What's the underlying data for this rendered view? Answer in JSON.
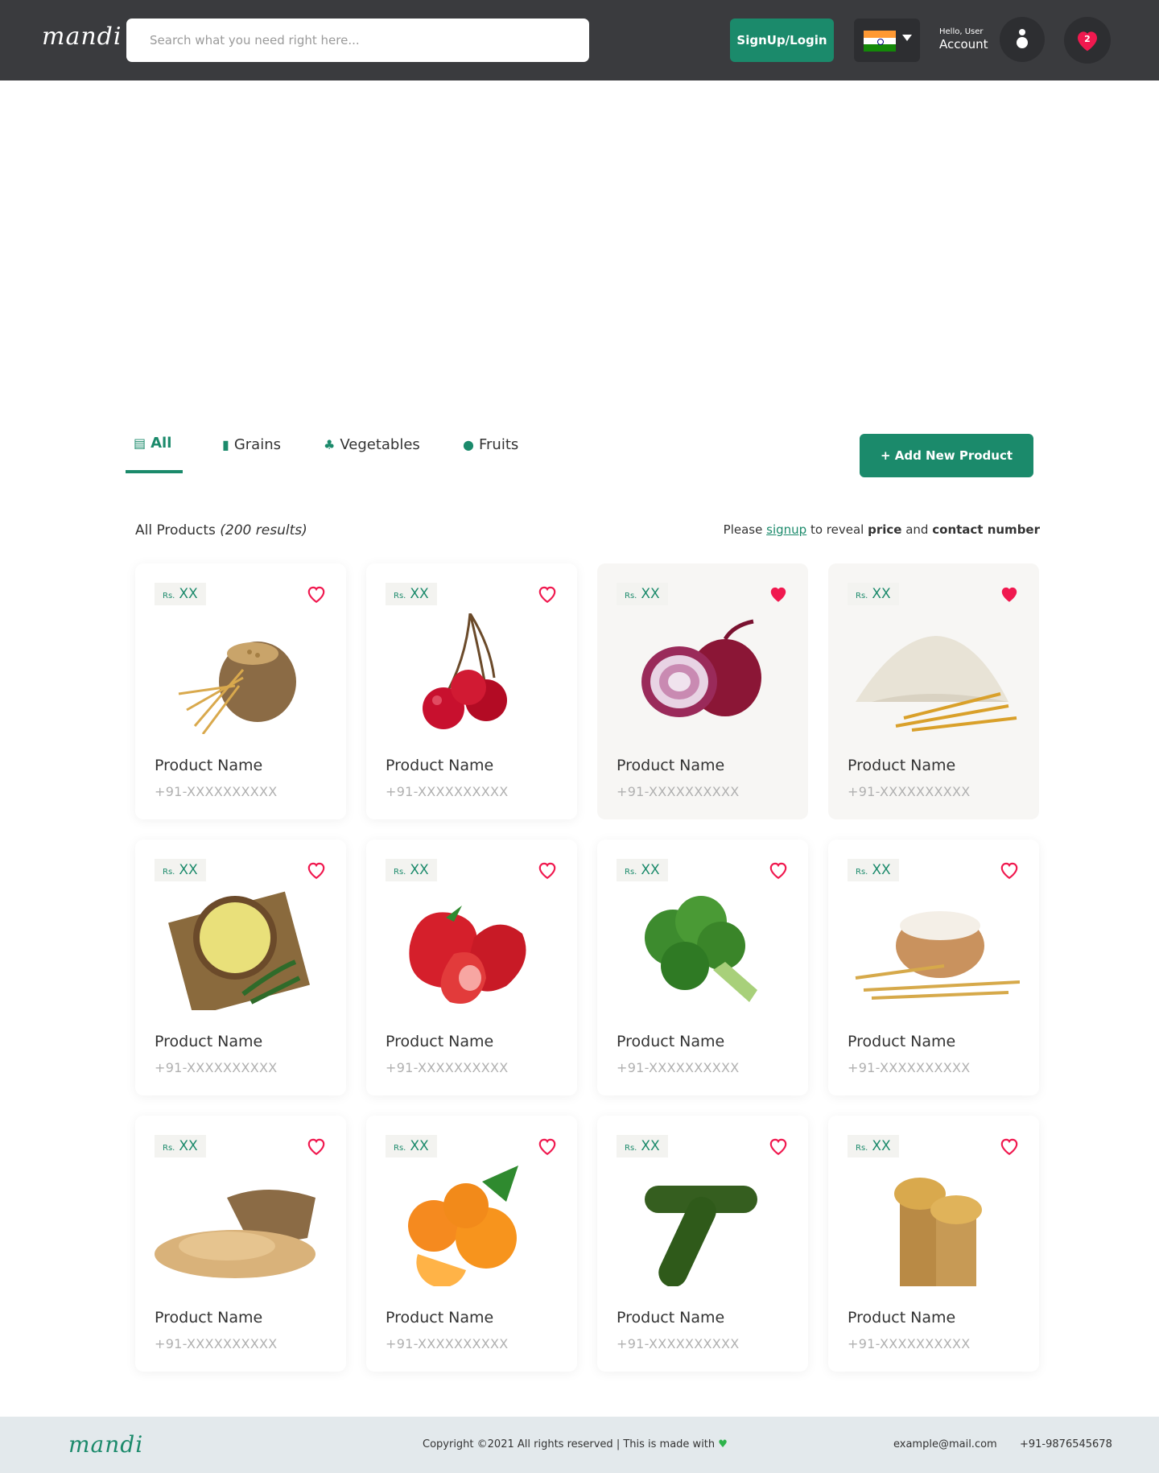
{
  "header": {
    "logo": "mandi",
    "search_placeholder": "Search what you need right here...",
    "signup_label": "SignUp/Login",
    "hello_text": "Hello, User",
    "account_label": "Account",
    "wishlist_count": "2"
  },
  "tabs": [
    {
      "label": "All",
      "icon": "document-icon"
    },
    {
      "label": "Grains",
      "icon": "grain-sack-icon"
    },
    {
      "label": "Vegetables",
      "icon": "vegetable-icon"
    },
    {
      "label": "Fruits",
      "icon": "apple-icon"
    }
  ],
  "add_product_label": "+ Add New Product",
  "results": {
    "label": "All Products",
    "count": "(200 results)"
  },
  "reveal": {
    "pre": "Please",
    "link": "signup",
    "mid": "to reveal",
    "price": "price",
    "and": "and",
    "contact": "contact number"
  },
  "colors": {
    "accent": "#1b8a6b",
    "header_bg": "#3a3b3e",
    "heart": "#f0194f",
    "footer_bg": "#e3e9ec"
  },
  "products": [
    {
      "currency": "Rs.",
      "price": "XX",
      "name": "Product Name",
      "phone": "+91-XXXXXXXXXX",
      "image": "wheat-sack",
      "favorited": false
    },
    {
      "currency": "Rs.",
      "price": "XX",
      "name": "Product Name",
      "phone": "+91-XXXXXXXXXX",
      "image": "cherries",
      "favorited": false
    },
    {
      "currency": "Rs.",
      "price": "XX",
      "name": "Product Name",
      "phone": "+91-XXXXXXXXXX",
      "image": "red-onion",
      "favorited": true
    },
    {
      "currency": "Rs.",
      "price": "XX",
      "name": "Product Name",
      "phone": "+91-XXXXXXXXXX",
      "image": "wheat-flour",
      "favorited": true
    },
    {
      "currency": "Rs.",
      "price": "XX",
      "name": "Product Name",
      "phone": "+91-XXXXXXXXXX",
      "image": "gram-flour-bowl",
      "favorited": false
    },
    {
      "currency": "Rs.",
      "price": "XX",
      "name": "Product Name",
      "phone": "+91-XXXXXXXXXX",
      "image": "strawberries",
      "favorited": false
    },
    {
      "currency": "Rs.",
      "price": "XX",
      "name": "Product Name",
      "phone": "+91-XXXXXXXXXX",
      "image": "broccoli",
      "favorited": false
    },
    {
      "currency": "Rs.",
      "price": "XX",
      "name": "Product Name",
      "phone": "+91-XXXXXXXXXX",
      "image": "rice-flour-bowl",
      "favorited": false
    },
    {
      "currency": "Rs.",
      "price": "XX",
      "name": "Product Name",
      "phone": "+91-XXXXXXXXXX",
      "image": "wheat-grain-sack",
      "favorited": false
    },
    {
      "currency": "Rs.",
      "price": "XX",
      "name": "Product Name",
      "phone": "+91-XXXXXXXXXX",
      "image": "oranges",
      "favorited": false
    },
    {
      "currency": "Rs.",
      "price": "XX",
      "name": "Product Name",
      "phone": "+91-XXXXXXXXXX",
      "image": "cucumber",
      "favorited": false
    },
    {
      "currency": "Rs.",
      "price": "XX",
      "name": "Product Name",
      "phone": "+91-XXXXXXXXXX",
      "image": "wheat-bundles",
      "favorited": false
    }
  ],
  "footer": {
    "logo": "mandi",
    "copyright": "Copyright ©2021 All rights reserved | This is made with",
    "email": "example@mail.com",
    "phone": "+91-9876545678"
  }
}
